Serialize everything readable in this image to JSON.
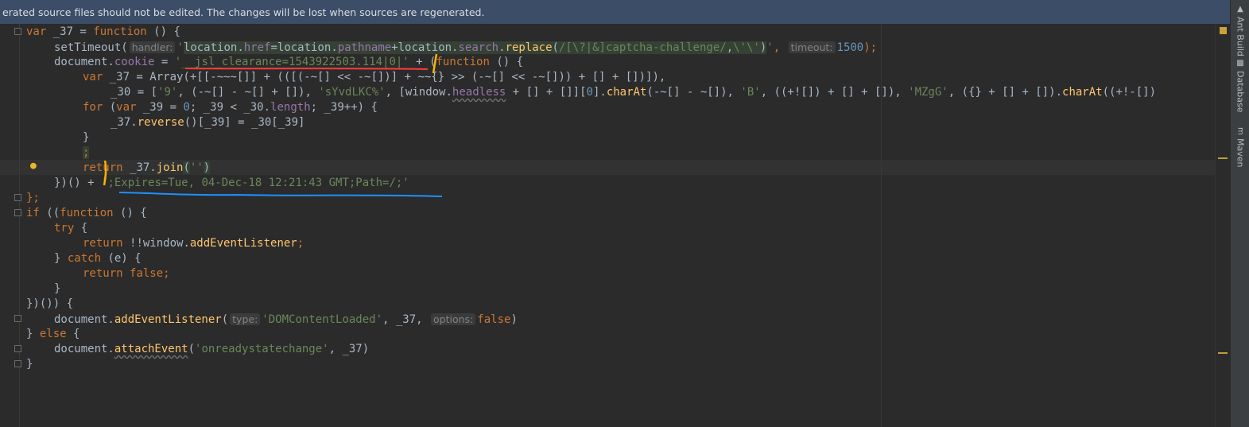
{
  "banner": {
    "text": "erated source files should not be edited. The changes will be lost when sources are regenerated."
  },
  "hints": {
    "handler": "handler:",
    "timeout": "timeout:",
    "type": "type:",
    "options": "options:"
  },
  "code": {
    "l1_a": "var ",
    "l1_b": "_37 = ",
    "l1_c": "function",
    "l1_d": " () {",
    "l2_fn": "setTimeout(",
    "l2_str_pre": "'",
    "l2_s1": "location.",
    "l2_s2": "href",
    "l2_s3": "=location.",
    "l2_s4": "pathname",
    "l2_s5": "+location.",
    "l2_s6": "search",
    "l2_s7": ".",
    "l2_s8": "replace",
    "l2_s9": "(",
    "l2_s10": "/[\\?|&]captcha-challenge/",
    "l2_s11": ",",
    "l2_s12": "\\'\\'",
    "l2_s13": ")",
    "l2_str_post": "'",
    "l2_comma": ", ",
    "l2_num": "1500",
    "l2_end": ");",
    "l3_a": "document.",
    "l3_b": "cookie",
    "l3_c": " = ",
    "l3_d": "'__jsl_clearance=1543922503.114|0|'",
    "l3_e": " + (",
    "l3_f": "function",
    "l3_g": " () {",
    "l4_a": "var ",
    "l4_b": "_37 = Array(+[[-~~~[]] + (([(-~[] << -~[])] + ~~{} >> (-~[] << -~[])) + [] + [])]),",
    "l5_a": "_30 = [",
    "l5_b": "'9'",
    "l5_c": ", (-~[] - ~[] + []), ",
    "l5_d": "'sYvdLKC%'",
    "l5_e": ", [window.",
    "l5_f": "headless",
    "l5_g": " + [] + []][",
    "l5_h": "0",
    "l5_i": "].",
    "l5_j": "charAt",
    "l5_k": "(-~[] - ~[]), ",
    "l5_l": "'B'",
    "l5_m": ", ((+![]) + [] + []), ",
    "l5_n": "'MZgG'",
    "l5_o": ", ({} + [] + []).",
    "l5_p": "charAt",
    "l5_q": "((+!-[])",
    "l6_a": "for ",
    "l6_b": "(",
    "l6_c": "var ",
    "l6_d": "_39 = ",
    "l6_e": "0",
    "l6_f": "; _39 < _30.",
    "l6_g": "length",
    "l6_h": "; _39++) {",
    "l7_a": "_37.",
    "l7_b": "reverse",
    "l7_c": "()[_39] = _30[_39]",
    "l8": "}",
    "l9": ";",
    "l10_a": "return ",
    "l10_b": "_37.",
    "l10_c": "join",
    "l10_d": "(",
    "l10_e": "''",
    "l10_f": ")",
    "l11_a": "})() + ",
    "l11_b": "';Expires=Tue, 04-Dec-18 12:21:43 GMT;Path=/;'",
    "l12": "};",
    "l13_a": "if ",
    "l13_b": "((",
    "l13_c": "function",
    "l13_d": " () {",
    "l14_a": "try ",
    "l14_b": "{",
    "l15_a": "return ",
    "l15_b": "!!window.",
    "l15_c": "addEventListener",
    "l15_d": ";",
    "l16_a": "} ",
    "l16_b": "catch ",
    "l16_c": "(e) {",
    "l17_a": "return ",
    "l17_b": "false",
    "l17_c": ";",
    "l18": "}",
    "l19": "})()) {",
    "l20_a": "document.",
    "l20_b": "addEventListener",
    "l20_c": "(",
    "l20_d": "'DOMContentLoaded'",
    "l20_e": ", _37, ",
    "l20_f": "false",
    "l20_g": ")",
    "l21_a": "} ",
    "l21_b": "else ",
    "l21_c": "{",
    "l22_a": "document.",
    "l22_b": "attachEvent",
    "l22_c": "(",
    "l22_d": "'onreadystatechange'",
    "l22_e": ", _37)",
    "l23": "}"
  },
  "tools": [
    {
      "label": "Ant Build",
      "icon": "ant-icon"
    },
    {
      "label": "Database",
      "icon": "database-icon"
    },
    {
      "label": "Maven",
      "icon": "maven-icon"
    }
  ],
  "colors": {
    "background": "#2b2b2b",
    "banner": "#3c4d67",
    "keyword": "#cc7832",
    "string": "#6a8759",
    "number": "#6897bb",
    "property": "#9876aa",
    "annotation_red": "#ff3b3b",
    "annotation_blue": "#1e90ff",
    "annotation_yellow": "#ffb400"
  }
}
